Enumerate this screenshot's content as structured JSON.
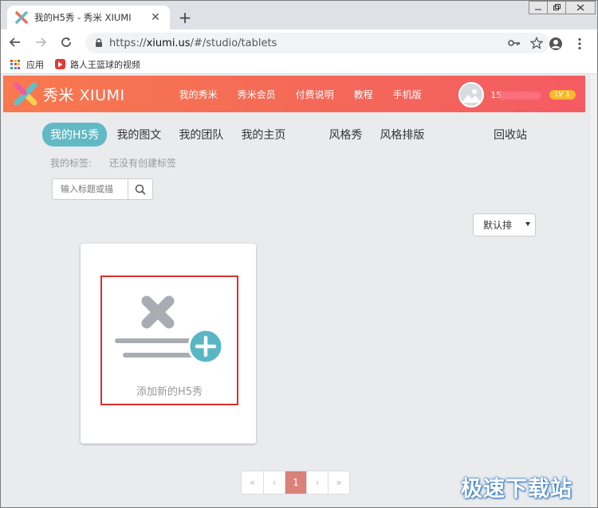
{
  "browser": {
    "tab_title": "我的H5秀 - 秀米 XIUMI",
    "new_tab": "+",
    "url_prefix": "https://",
    "url_host": "xiumi.us",
    "url_path": "/#/studio/tablets",
    "bookmarks": [
      {
        "label": "应用"
      },
      {
        "label": "路人王篮球的视频"
      }
    ]
  },
  "site": {
    "logo_text": "秀米 XIUMI",
    "nav": [
      "我的秀米",
      "秀米会员",
      "付费说明",
      "教程",
      "手机版"
    ],
    "user_name_prefix": "15",
    "level": "LV 1"
  },
  "studio": {
    "tabs": [
      "我的H5秀",
      "我的图文",
      "我的团队",
      "我的主页",
      "风格秀",
      "风格排版",
      "回收站"
    ],
    "active_tab": "我的H5秀",
    "tags_label": "我的标签:",
    "tags_empty": "还没有创建标签",
    "search_placeholder": "输入标题或描",
    "sort_label": "默认排",
    "add_card_label": "添加新的H5秀"
  },
  "pagination": {
    "first": "«",
    "prev": "‹",
    "current": "1",
    "next": "›",
    "last": "»"
  },
  "watermark": "极速下载站",
  "colors": {
    "header_start": "#f8794f",
    "header_end": "#f45b63",
    "active_tab": "#62b9c6",
    "add_plus": "#5ab6c4",
    "highlight_border": "#d9302f",
    "level_badge": "#f9b92c",
    "page_current": "#d9827a"
  }
}
